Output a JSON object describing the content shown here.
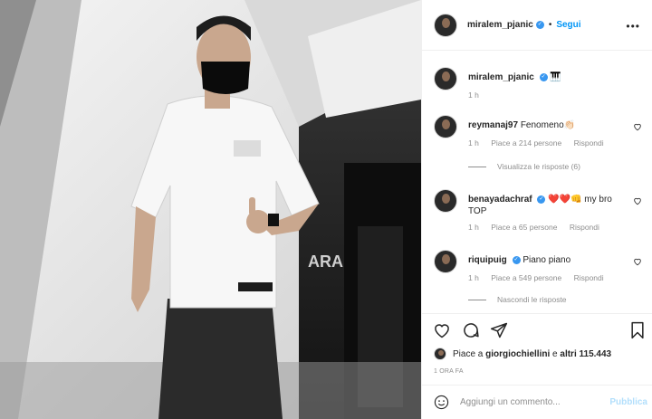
{
  "header": {
    "username": "miralem_pjanic",
    "separator": "•",
    "follow_label": "Segui",
    "more_icon": "more-horizontal-icon"
  },
  "caption": {
    "username": "miralem_pjanic",
    "text": "🎹",
    "time": "1 h"
  },
  "comments": [
    {
      "username": "reymanaj97",
      "verified": false,
      "text": "Fenomeno👏🏻",
      "time": "1 h",
      "likes": "Piace a 214 persone",
      "reply": "Rispondi",
      "replies_toggle": "Visualizza le risposte (6)"
    },
    {
      "username": "benayadachraf",
      "verified": true,
      "text": "❤️❤️👊 my bro TOP",
      "time": "1 h",
      "likes": "Piace a 65 persone",
      "reply": "Rispondi"
    },
    {
      "username": "riquipuig",
      "verified": true,
      "text": "Piano piano",
      "time": "1 h",
      "likes": "Piace a 549 persone",
      "reply": "Rispondi",
      "replies_toggle": "Nascondi le risposte"
    }
  ],
  "likes": {
    "prefix": "Piace a ",
    "user": "giorgiochiellini",
    "suffix": " e ",
    "others": "altri 115.443"
  },
  "timestamp": "1 ORA FA",
  "add_comment": {
    "placeholder": "Aggiungi un commento...",
    "publish": "Pubblica"
  },
  "colors": {
    "link": "#0095f6",
    "muted": "#8e8e8e",
    "text": "#262626",
    "verified": "#3897f0",
    "publish_disabled": "#b2dffc"
  }
}
